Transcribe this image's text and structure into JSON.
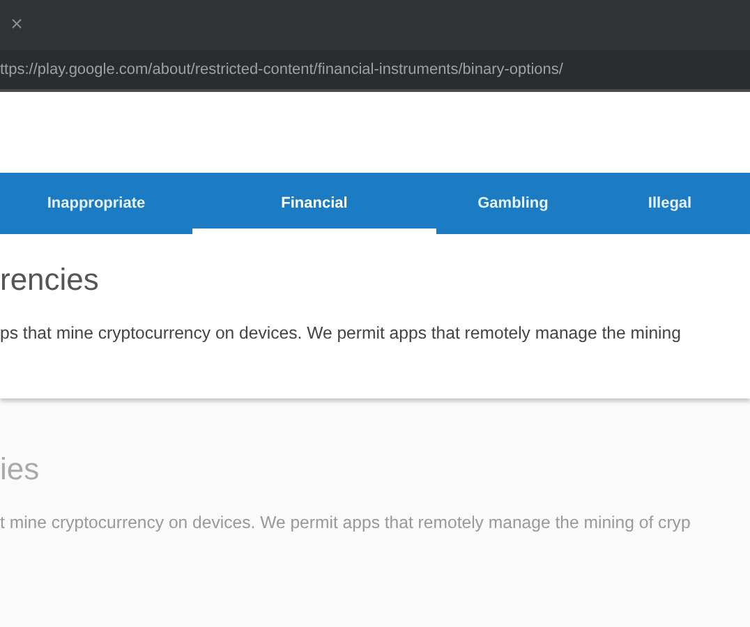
{
  "window": {
    "close_glyph": "×"
  },
  "address_bar": {
    "url": "ttps://play.google.com/about/restricted-content/financial-instruments/binary-options/"
  },
  "tabs": [
    {
      "label": "Inappropriate",
      "selected": false
    },
    {
      "label": "Financial",
      "selected": true
    },
    {
      "label": "Gambling",
      "selected": false
    },
    {
      "label": "Illegal",
      "selected": false
    }
  ],
  "sections": [
    {
      "heading": "rencies",
      "text": "ps that mine cryptocurrency on devices. We permit apps that remotely manage the mining",
      "raised": true
    },
    {
      "heading": "ies",
      "text": "t mine cryptocurrency on devices. We permit apps that remotely manage the mining of cryp",
      "raised": false
    }
  ]
}
